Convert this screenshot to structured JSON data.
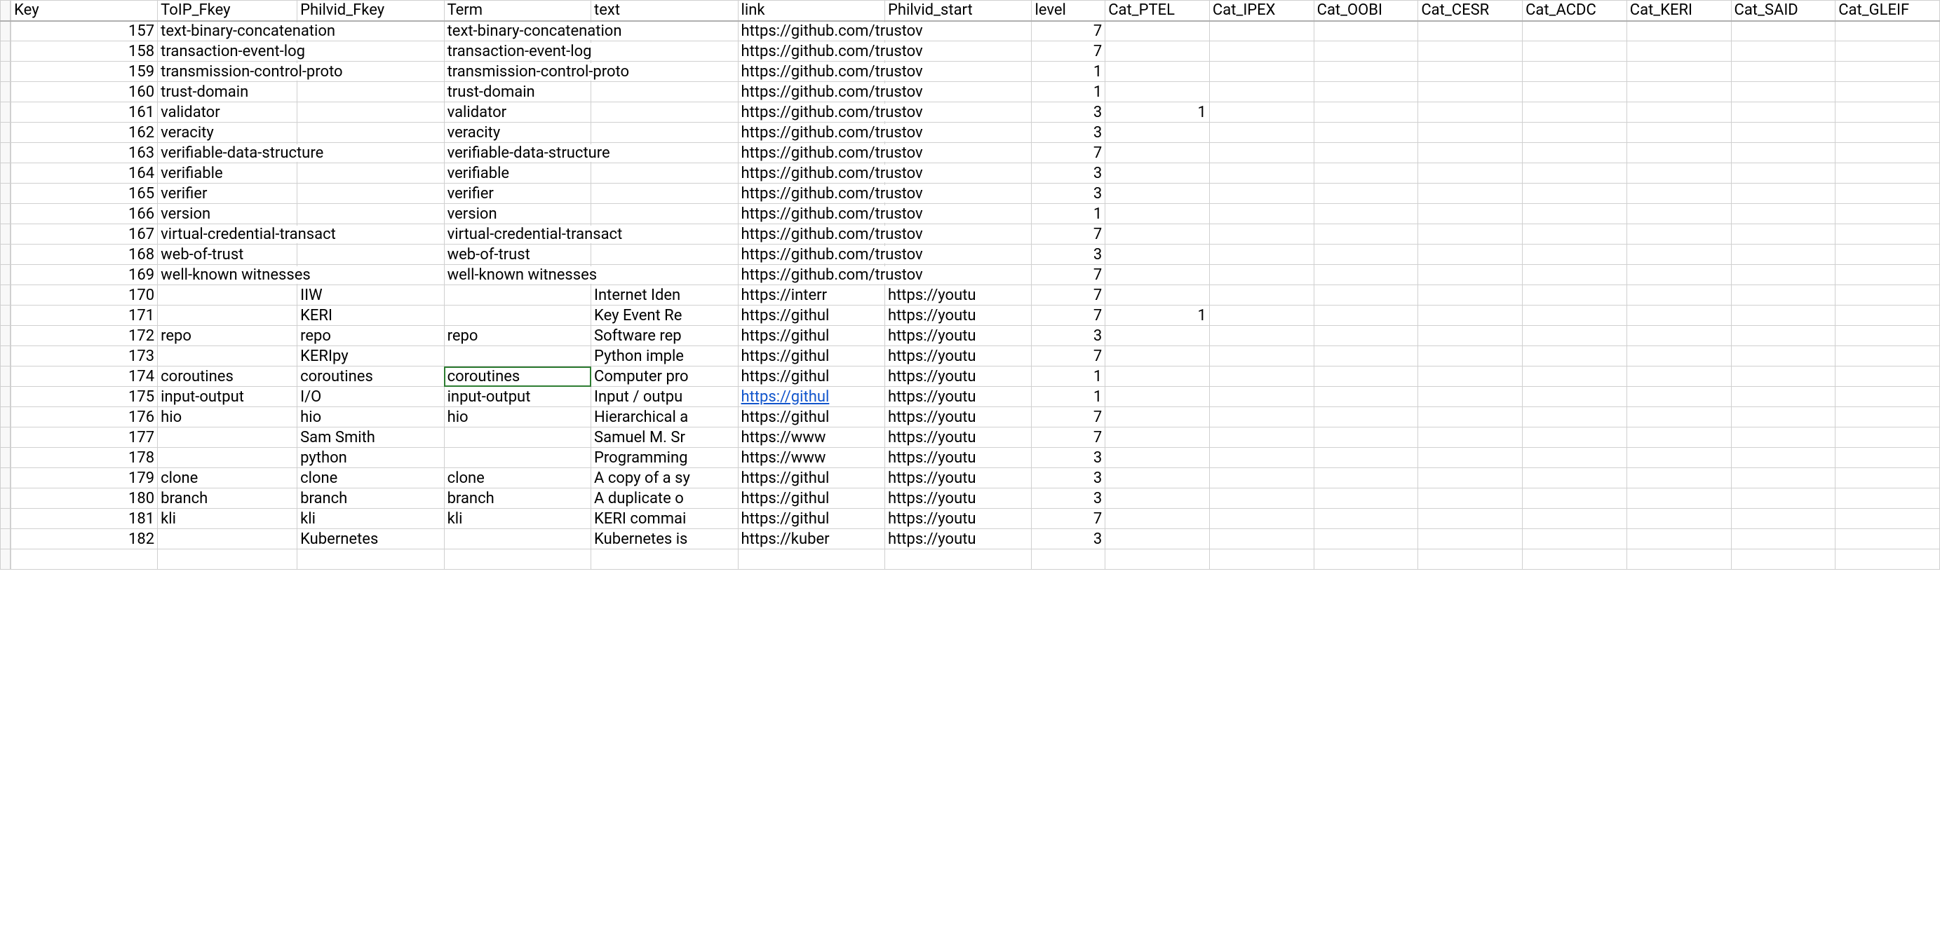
{
  "headers": {
    "A": "Key",
    "B": "ToIP_Fkey",
    "C": "Philvid_Fkey",
    "D": "Term",
    "E": "text",
    "F": "link",
    "G": "Philvid_start",
    "H": "level",
    "I": "Cat_PTEL",
    "J": "Cat_IPEX",
    "K": "Cat_OOBI",
    "L": "Cat_CESR",
    "M": "Cat_ACDC",
    "N": "Cat_KERI",
    "O": "Cat_SAID",
    "P": "Cat_GLEIF"
  },
  "rows": [
    {
      "Key": "157",
      "ToIP_Fkey": "text-binary-concatenation",
      "Philvid_Fkey": "",
      "Term": "text-binary-concatenation",
      "text": "",
      "link": "https://github.com/trustov",
      "Philvid_start": "",
      "level": "7",
      "Cat_PTEL": "",
      "link_styled": false
    },
    {
      "Key": "158",
      "ToIP_Fkey": "transaction-event-log",
      "Philvid_Fkey": "",
      "Term": "transaction-event-log",
      "text": "",
      "link": "https://github.com/trustov",
      "Philvid_start": "",
      "level": "7",
      "Cat_PTEL": "",
      "link_styled": false
    },
    {
      "Key": "159",
      "ToIP_Fkey": "transmission-control-proto",
      "Philvid_Fkey": "",
      "Term": "transmission-control-proto",
      "text": "",
      "link": "https://github.com/trustov",
      "Philvid_start": "",
      "level": "1",
      "Cat_PTEL": "",
      "link_styled": false
    },
    {
      "Key": "160",
      "ToIP_Fkey": "trust-domain",
      "Philvid_Fkey": "",
      "Term": "trust-domain",
      "text": "",
      "link": "https://github.com/trustov",
      "Philvid_start": "",
      "level": "1",
      "Cat_PTEL": "",
      "link_styled": false
    },
    {
      "Key": "161",
      "ToIP_Fkey": "validator",
      "Philvid_Fkey": "",
      "Term": "validator",
      "text": "",
      "link": "https://github.com/trustov",
      "Philvid_start": "",
      "level": "3",
      "Cat_PTEL": "1",
      "link_styled": false
    },
    {
      "Key": "162",
      "ToIP_Fkey": "veracity",
      "Philvid_Fkey": "",
      "Term": "veracity",
      "text": "",
      "link": "https://github.com/trustov",
      "Philvid_start": "",
      "level": "3",
      "Cat_PTEL": "",
      "link_styled": false
    },
    {
      "Key": "163",
      "ToIP_Fkey": "verifiable-data-structure",
      "Philvid_Fkey": "",
      "Term": "verifiable-data-structure",
      "text": "",
      "link": "https://github.com/trustov",
      "Philvid_start": "",
      "level": "7",
      "Cat_PTEL": "",
      "link_styled": false
    },
    {
      "Key": "164",
      "ToIP_Fkey": "verifiable",
      "Philvid_Fkey": "",
      "Term": "verifiable",
      "text": "",
      "link": "https://github.com/trustov",
      "Philvid_start": "",
      "level": "3",
      "Cat_PTEL": "",
      "link_styled": false
    },
    {
      "Key": "165",
      "ToIP_Fkey": "verifier",
      "Philvid_Fkey": "",
      "Term": "verifier",
      "text": "",
      "link": "https://github.com/trustov",
      "Philvid_start": "",
      "level": "3",
      "Cat_PTEL": "",
      "link_styled": false
    },
    {
      "Key": "166",
      "ToIP_Fkey": "version",
      "Philvid_Fkey": "",
      "Term": "version",
      "text": "",
      "link": "https://github.com/trustov",
      "Philvid_start": "",
      "level": "1",
      "Cat_PTEL": "",
      "link_styled": false
    },
    {
      "Key": "167",
      "ToIP_Fkey": "virtual-credential-transact",
      "Philvid_Fkey": "",
      "Term": "virtual-credential-transact",
      "text": "",
      "link": "https://github.com/trustov",
      "Philvid_start": "",
      "level": "7",
      "Cat_PTEL": "",
      "link_styled": false
    },
    {
      "Key": "168",
      "ToIP_Fkey": "web-of-trust",
      "Philvid_Fkey": "",
      "Term": "web-of-trust",
      "text": "",
      "link": "https://github.com/trustov",
      "Philvid_start": "",
      "level": "3",
      "Cat_PTEL": "",
      "link_styled": false
    },
    {
      "Key": "169",
      "ToIP_Fkey": "well-known witnesses",
      "Philvid_Fkey": "",
      "Term": "well-known witnesses",
      "text": "",
      "link": "https://github.com/trustov",
      "Philvid_start": "",
      "level": "7",
      "Cat_PTEL": "",
      "link_styled": false
    },
    {
      "Key": "170",
      "ToIP_Fkey": "",
      "Philvid_Fkey": "IIW",
      "Term": "",
      "text": "Internet Iden",
      "link": "https://interr",
      "Philvid_start": "https://youtu",
      "level": "7",
      "Cat_PTEL": "",
      "link_styled": false
    },
    {
      "Key": "171",
      "ToIP_Fkey": "",
      "Philvid_Fkey": "KERI",
      "Term": "",
      "text": "Key Event Re",
      "link": "https://githul",
      "Philvid_start": "https://youtu",
      "level": "7",
      "Cat_PTEL": "1",
      "link_styled": false
    },
    {
      "Key": "172",
      "ToIP_Fkey": "repo",
      "Philvid_Fkey": "repo",
      "Term": "repo",
      "text": "Software rep",
      "link": "https://githul",
      "Philvid_start": "https://youtu",
      "level": "3",
      "Cat_PTEL": "",
      "link_styled": false
    },
    {
      "Key": "173",
      "ToIP_Fkey": "",
      "Philvid_Fkey": "KERIpy",
      "Term": "",
      "text": "Python imple",
      "link": "https://githul",
      "Philvid_start": "https://youtu",
      "level": "7",
      "Cat_PTEL": "",
      "link_styled": false
    },
    {
      "Key": "174",
      "ToIP_Fkey": "coroutines",
      "Philvid_Fkey": "coroutines",
      "Term": "coroutines",
      "text": "Computer pro",
      "link": "https://githul",
      "Philvid_start": "https://youtu",
      "level": "1",
      "Cat_PTEL": "",
      "link_styled": false,
      "selected": "D"
    },
    {
      "Key": "175",
      "ToIP_Fkey": "input-output",
      "Philvid_Fkey": "I/O",
      "Term": "input-output",
      "text": "Input / outpu",
      "link": "https://githul",
      "Philvid_start": "https://youtu",
      "level": "1",
      "Cat_PTEL": "",
      "link_styled": true
    },
    {
      "Key": "176",
      "ToIP_Fkey": "hio",
      "Philvid_Fkey": "hio",
      "Term": "hio",
      "text": "Hierarchical a",
      "link": "https://githul",
      "Philvid_start": "https://youtu",
      "level": "7",
      "Cat_PTEL": "",
      "link_styled": false
    },
    {
      "Key": "177",
      "ToIP_Fkey": "",
      "Philvid_Fkey": "Sam Smith",
      "Term": "",
      "text": "Samuel M. Sr",
      "link": "https://www",
      "Philvid_start": "https://youtu",
      "level": "7",
      "Cat_PTEL": "",
      "link_styled": false
    },
    {
      "Key": "178",
      "ToIP_Fkey": "",
      "Philvid_Fkey": "python",
      "Term": "",
      "text": "Programming",
      "link": "https://www",
      "Philvid_start": "https://youtu",
      "level": "3",
      "Cat_PTEL": "",
      "link_styled": false
    },
    {
      "Key": "179",
      "ToIP_Fkey": "clone",
      "Philvid_Fkey": "clone",
      "Term": "clone",
      "text": "A copy of a sy",
      "link": "https://githul",
      "Philvid_start": "https://youtu",
      "level": "3",
      "Cat_PTEL": "",
      "link_styled": false
    },
    {
      "Key": "180",
      "ToIP_Fkey": "branch",
      "Philvid_Fkey": "branch",
      "Term": "branch",
      "text": "A duplicate o",
      "link": "https://githul",
      "Philvid_start": "https://youtu",
      "level": "3",
      "Cat_PTEL": "",
      "link_styled": false
    },
    {
      "Key": "181",
      "ToIP_Fkey": "kli",
      "Philvid_Fkey": "kli",
      "Term": "kli",
      "text": "KERI commai",
      "link": "https://githul",
      "Philvid_start": "https://youtu",
      "level": "7",
      "Cat_PTEL": "",
      "link_styled": false
    },
    {
      "Key": "182",
      "ToIP_Fkey": "",
      "Philvid_Fkey": "Kubernetes",
      "Term": "",
      "text": "Kubernetes is",
      "link": "https://kuber",
      "Philvid_start": "https://youtu",
      "level": "3",
      "Cat_PTEL": "",
      "link_styled": false
    }
  ]
}
